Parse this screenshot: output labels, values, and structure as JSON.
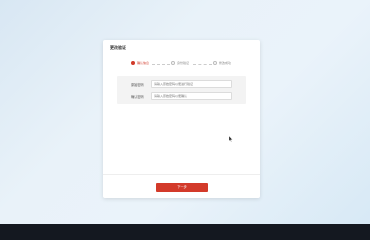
{
  "dialog": {
    "title": "更改验证",
    "steps": [
      {
        "label": "确认信息",
        "active": true
      },
      {
        "label": "身份验证",
        "active": false
      },
      {
        "label": "修改成功",
        "active": false
      }
    ],
    "form": {
      "fields": [
        {
          "label": "原始密码",
          "placeholder": "请输入原始密码以便进行验证"
        },
        {
          "label": "确认密码",
          "placeholder": "请输入原始密码以便确认"
        }
      ]
    },
    "next_button": "下一步"
  },
  "colors": {
    "accent": "#d33a2a",
    "background": "#e6f0f8",
    "taskbar": "#141820"
  }
}
